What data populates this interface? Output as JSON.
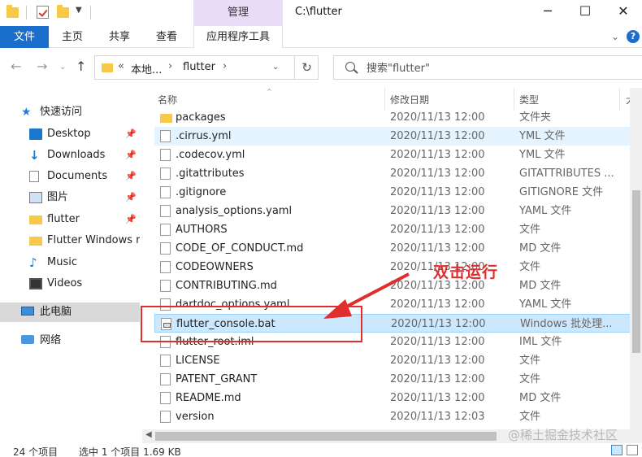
{
  "titlebar": {
    "manage_tab": "管理",
    "title": "C:\\flutter",
    "minimize": "─",
    "maximize": "☐",
    "close": "✕"
  },
  "ribbon": {
    "tabs": [
      "文件",
      "主页",
      "共享",
      "查看"
    ],
    "app_tools": "应用程序工具",
    "collapse": "⌄",
    "help": "?"
  },
  "address": {
    "overflow": "«",
    "segments": [
      "本地...",
      "flutter"
    ],
    "search_placeholder": "搜索\"flutter\""
  },
  "sidebar": {
    "items": [
      {
        "label": "快速访问",
        "icon": "star-icon",
        "pinned": false,
        "level": "top"
      },
      {
        "label": "Desktop",
        "icon": "desktop-icon",
        "pinned": true
      },
      {
        "label": "Downloads",
        "icon": "download-icon",
        "pinned": true
      },
      {
        "label": "Documents",
        "icon": "document-icon",
        "pinned": true
      },
      {
        "label": "图片",
        "icon": "picture-icon",
        "pinned": true
      },
      {
        "label": "flutter",
        "icon": "folder-icon",
        "pinned": true
      },
      {
        "label": "Flutter Windows r",
        "icon": "folder-icon",
        "pinned": false
      },
      {
        "label": "Music",
        "icon": "music-icon",
        "pinned": false
      },
      {
        "label": "Videos",
        "icon": "video-icon",
        "pinned": false
      },
      {
        "label": "此电脑",
        "icon": "computer-icon",
        "pinned": false,
        "level": "top",
        "selected": true
      },
      {
        "label": "网络",
        "icon": "network-icon",
        "pinned": false,
        "level": "top"
      }
    ]
  },
  "columns": {
    "name": "名称",
    "date": "修改日期",
    "type": "类型",
    "size": "大"
  },
  "files": [
    {
      "name": "packages",
      "date": "2020/11/13 12:00",
      "type": "文件夹",
      "icon": "folder-icon"
    },
    {
      "name": ".cirrus.yml",
      "date": "2020/11/13 12:00",
      "type": "YML 文件",
      "icon": "file-icon",
      "hover": true
    },
    {
      "name": ".codecov.yml",
      "date": "2020/11/13 12:00",
      "type": "YML 文件",
      "icon": "file-icon"
    },
    {
      "name": ".gitattributes",
      "date": "2020/11/13 12:00",
      "type": "GITATTRIBUTES ...",
      "icon": "file-icon"
    },
    {
      "name": ".gitignore",
      "date": "2020/11/13 12:00",
      "type": "GITIGNORE 文件",
      "icon": "file-icon"
    },
    {
      "name": "analysis_options.yaml",
      "date": "2020/11/13 12:00",
      "type": "YAML 文件",
      "icon": "file-icon"
    },
    {
      "name": "AUTHORS",
      "date": "2020/11/13 12:00",
      "type": "文件",
      "icon": "file-icon"
    },
    {
      "name": "CODE_OF_CONDUCT.md",
      "date": "2020/11/13 12:00",
      "type": "MD 文件",
      "icon": "file-icon"
    },
    {
      "name": "CODEOWNERS",
      "date": "2020/11/13 12:00",
      "type": "文件",
      "icon": "file-icon"
    },
    {
      "name": "CONTRIBUTING.md",
      "date": "2020/11/13 12:00",
      "type": "MD 文件",
      "icon": "file-icon"
    },
    {
      "name": "dartdoc_options.yaml",
      "date": "2020/11/13 12:00",
      "type": "YAML 文件",
      "icon": "file-icon"
    },
    {
      "name": "flutter_console.bat",
      "date": "2020/11/13 12:00",
      "type": "Windows 批处理...",
      "icon": "batch-file-icon",
      "selected": true
    },
    {
      "name": "flutter_root.iml",
      "date": "2020/11/13 12:00",
      "type": "IML 文件",
      "icon": "file-icon"
    },
    {
      "name": "LICENSE",
      "date": "2020/11/13 12:00",
      "type": "文件",
      "icon": "file-icon"
    },
    {
      "name": "PATENT_GRANT",
      "date": "2020/11/13 12:00",
      "type": "文件",
      "icon": "file-icon"
    },
    {
      "name": "README.md",
      "date": "2020/11/13 12:00",
      "type": "MD 文件",
      "icon": "file-icon"
    },
    {
      "name": "version",
      "date": "2020/11/13 12:03",
      "type": "文件",
      "icon": "file-icon"
    }
  ],
  "annotation": {
    "text": "双击运行",
    "color": "#e02d2d"
  },
  "status": {
    "count": "24 个项目",
    "selection": "选中 1 个项目  1.69 KB"
  },
  "watermark": "@稀土掘金技术社区",
  "colors": {
    "accent": "#1a6ecc",
    "manage_tab": "#e9dcf6",
    "selected_row": "#cce8ff",
    "hover_row": "#e5f3ff"
  }
}
